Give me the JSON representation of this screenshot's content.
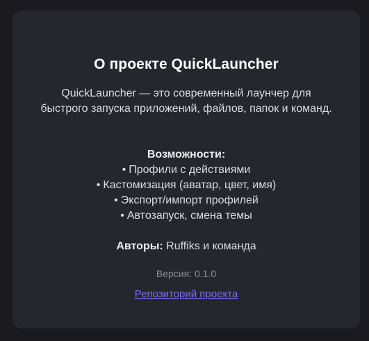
{
  "about": {
    "title": "О проекте QuickLauncher",
    "description": "QuickLauncher — это современный лаунчер для быстрого запуска приложений, файлов, папок и команд.",
    "features_heading": "Возможности:",
    "features": [
      "Профили с действиями",
      "Кастомизация (аватар, цвет, имя)",
      "Экспорт/импорт профилей",
      "Автозапуск, смена темы"
    ],
    "bullet": "•",
    "authors_label": "Авторы:",
    "authors_value": "Ruffiks и команда",
    "version": "Версия: 0.1.0",
    "repo_link_label": "Репозиторий проекта"
  },
  "colors": {
    "background": "#1b1b1f",
    "card": "#26272c",
    "link": "#7f6ef5",
    "muted": "#8c8c92"
  }
}
